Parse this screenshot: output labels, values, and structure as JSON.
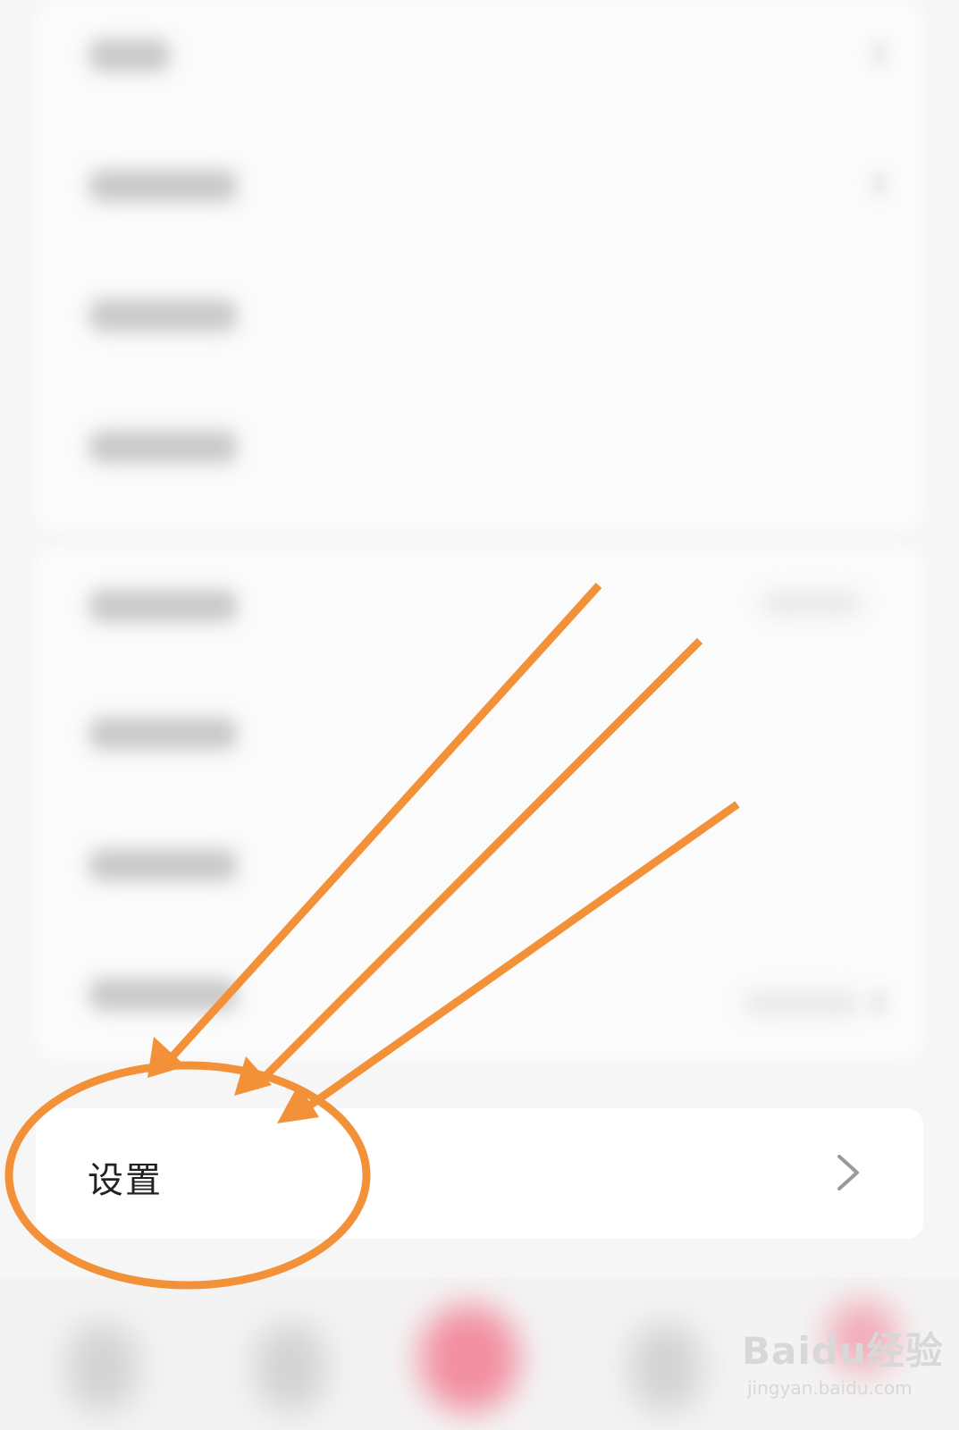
{
  "settings_row": {
    "label": "设置",
    "chevron": "chevron-right-icon"
  },
  "annotation": {
    "color": "#f39138",
    "arrow_count": 3,
    "shape": "ellipse"
  },
  "watermark": {
    "brand": "Baidu经验",
    "url": "jingyan.baidu.com"
  },
  "colors": {
    "page_bg": "#f6f6f6",
    "row_bg": "#ffffff",
    "accent_tab": "#f27d92"
  }
}
